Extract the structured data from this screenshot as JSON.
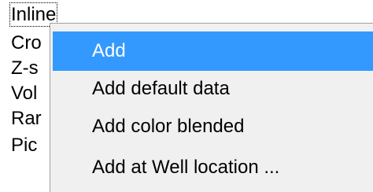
{
  "background_list": {
    "items": [
      {
        "label": "Inline",
        "focused": true
      },
      {
        "label": "Cro"
      },
      {
        "label": "Z-s"
      },
      {
        "label": "Vol"
      },
      {
        "label": "Rar"
      },
      {
        "label": "Pic"
      }
    ]
  },
  "context_menu": {
    "highlighted_index": 0,
    "items": [
      {
        "label": "Add"
      },
      {
        "label": "Add default data"
      },
      {
        "label": "Add color blended"
      },
      {
        "label": "Add at Well location ..."
      }
    ]
  },
  "colors": {
    "highlight": "#3399ff",
    "menu_background": "#f0f0f0",
    "menu_border": "#a0a0a0"
  }
}
